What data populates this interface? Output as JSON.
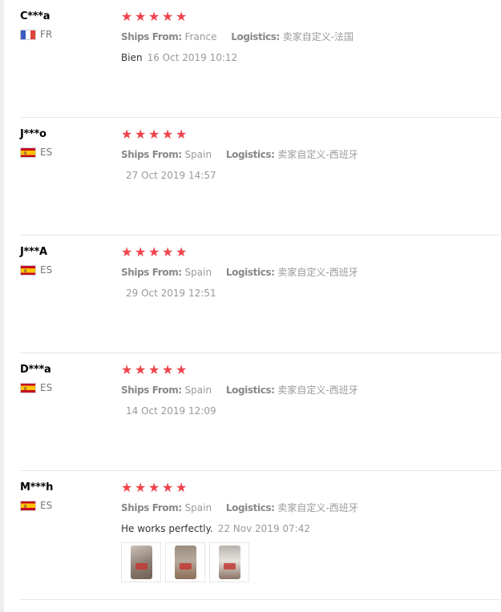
{
  "labels": {
    "ships_from": "Ships From:",
    "logistics": "Logistics:"
  },
  "colors": {
    "star": "#f0434c",
    "muted_text": "#999999",
    "divider": "#e8e8e8"
  },
  "reviews": [
    {
      "user": "C***a",
      "country_code": "FR",
      "flag": "flag-france-icon",
      "rating": 5,
      "ships_from": "France",
      "logistics": "卖家自定义-法国",
      "comment": "Bien",
      "date": "16 Oct 2019 10:12",
      "photos": []
    },
    {
      "user": "J***o",
      "country_code": "ES",
      "flag": "flag-spain-icon",
      "rating": 5,
      "ships_from": "Spain",
      "logistics": "卖家自定义-西班牙",
      "comment": "",
      "date": "27 Oct 2019 14:57",
      "photos": []
    },
    {
      "user": "J***A",
      "country_code": "ES",
      "flag": "flag-spain-icon",
      "rating": 5,
      "ships_from": "Spain",
      "logistics": "卖家自定义-西班牙",
      "comment": "",
      "date": "29 Oct 2019 12:51",
      "photos": []
    },
    {
      "user": "D***a",
      "country_code": "ES",
      "flag": "flag-spain-icon",
      "rating": 5,
      "ships_from": "Spain",
      "logistics": "卖家自定义-西班牙",
      "comment": "",
      "date": "14 Oct 2019 12:09",
      "photos": []
    },
    {
      "user": "M***h",
      "country_code": "ES",
      "flag": "flag-spain-icon",
      "rating": 5,
      "ships_from": "Spain",
      "logistics": "卖家自定义-西班牙",
      "comment": "He works perfectly.",
      "date": "22 Nov 2019 07:42",
      "photos": [
        "review-photo-1",
        "review-photo-2",
        "review-photo-3"
      ]
    }
  ]
}
